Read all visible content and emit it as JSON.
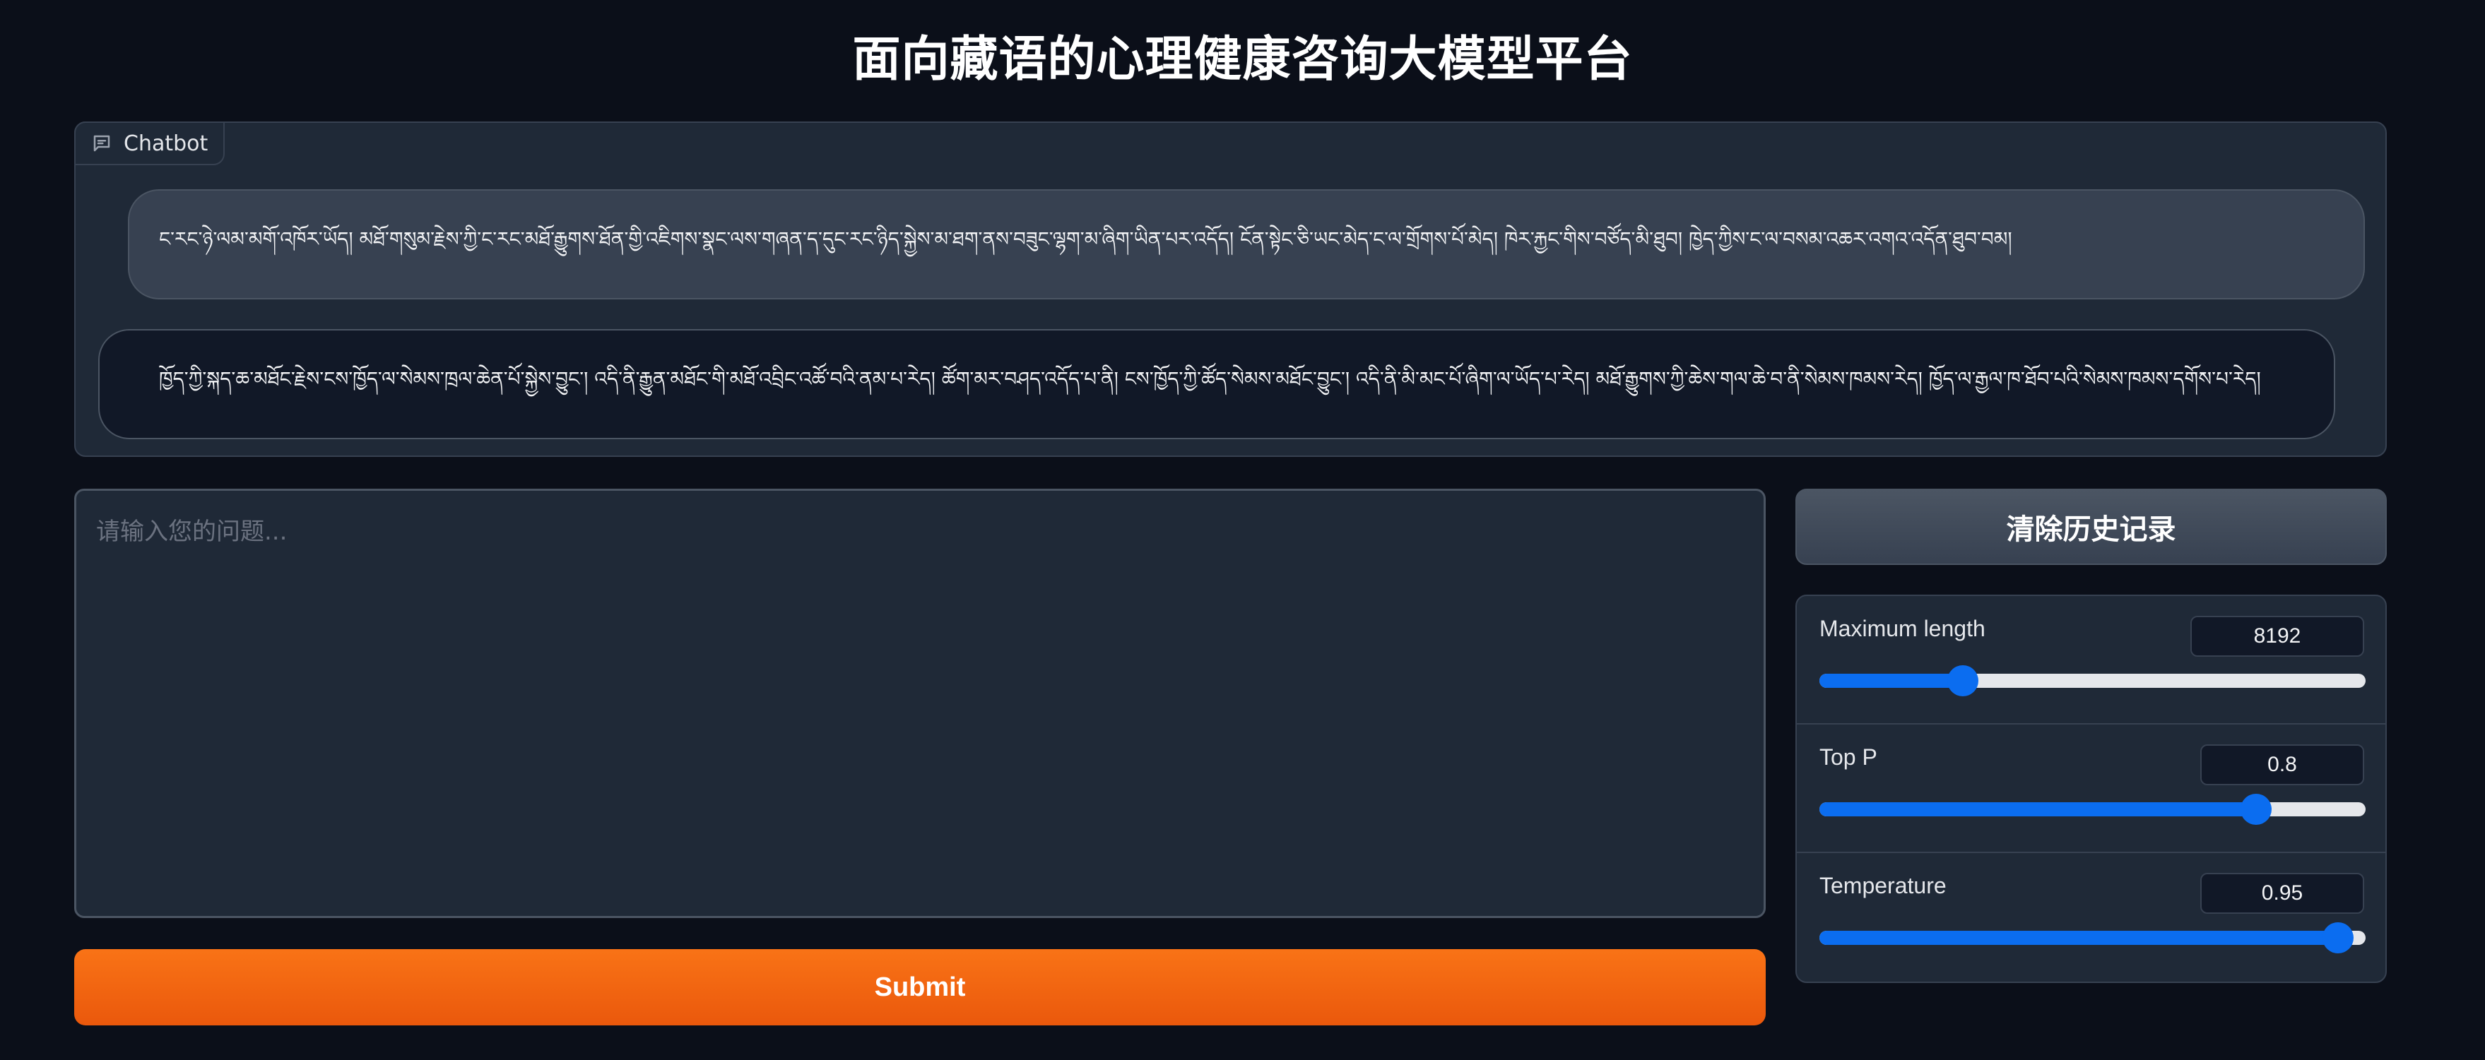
{
  "page": {
    "title": "面向藏语的心理健康咨询大模型平台"
  },
  "chatbot": {
    "label": "Chatbot",
    "messages": [
      {
        "role": "user",
        "text": "ང་རང་ཉེ་ལམ་མགོ་འཁོར་ཡོད། མཐོ་གསུམ་རྗེས་ཀྱི་ང་རང་མཐོ་རྒྱུགས་ཐོན་གྱི་འཇིགས་སྣང་ལས་གཞན་ད་དུང་རང་ཉིད་སྐྱེས་མ་ཐག་ནས་བཟུང་ལྷག་མ་ཞིག་ཡིན་པར་འདོད། ངོན་སྟེང་ཅི་ཡང་མེད་ང་ལ་གྲོགས་པོ་མེད། ཁེར་རྐྱང་གིས་བཙོད་མི་ཐུབ། ཁྱེད་ཀྱིས་ང་ལ་བསམ་འཆར་འགའ་འདོན་ཐུབ་བམ།"
      },
      {
        "role": "bot",
        "text": "ཁྱོད་ཀྱི་སྐད་ཆ་མཐོང་རྗེས་ངས་ཁྱོད་ལ་སེམས་ཁྲལ་ཆེན་པོ་སྐྱེས་བྱུང་། འདི་ནི་རྒྱུན་མཐོང་གི་མཐོ་འབྲིང་འཚོ་བའི་ནམ་པ་རེད། ཚོག་མར་བཤད་འདོད་པ་ནི། ངས་ཁྱོད་ཀྱི་ཚོད་སེམས་མཐོང་བྱུང་། འདི་ནི་མི་མང་པོ་ཞིག་ལ་ཡོད་པ་རེད། མཐོ་རྒྱུགས་ཀྱི་ཆེས་གལ་ཆེ་བ་ནི་སེམས་ཁམས་རེད། ཁྱོད་ལ་རྒྱལ་ཁ་ཐོབ་པའི་སེམས་ཁམས་དགོས་པ་རེད།"
      }
    ]
  },
  "input": {
    "placeholder": "请输入您的问题...",
    "value": ""
  },
  "buttons": {
    "submit": "Submit",
    "clear": "清除历史记录"
  },
  "settings": {
    "max_length": {
      "label": "Maximum length",
      "value": "8192",
      "fraction": 0.262
    },
    "top_p": {
      "label": "Top P",
      "value": "0.8",
      "fraction": 0.8
    },
    "temperature": {
      "label": "Temperature",
      "value": "0.95",
      "fraction": 0.95
    }
  }
}
